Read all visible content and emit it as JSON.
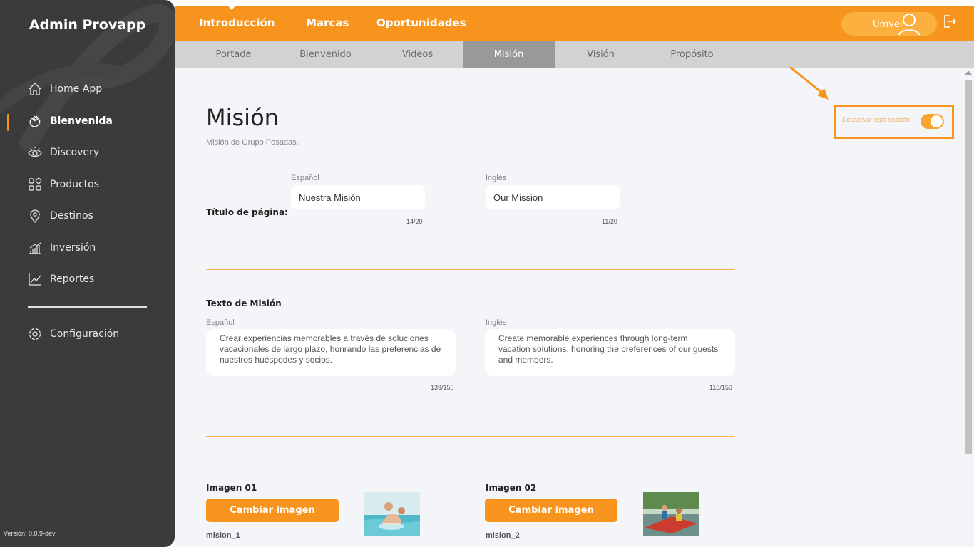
{
  "app": {
    "title": "Admin Provapp",
    "version": "Versión: 0.0.9-dev"
  },
  "sidebar": {
    "items": [
      {
        "label": "Home App",
        "icon": "home-icon"
      },
      {
        "label": "Bienvenida",
        "icon": "wave-hand-icon",
        "active": true
      },
      {
        "label": "Discovery",
        "icon": "eye-icon"
      },
      {
        "label": "Productos",
        "icon": "grid-icon"
      },
      {
        "label": "Destinos",
        "icon": "location-pin-icon"
      },
      {
        "label": "Inversión",
        "icon": "bar-chart-icon"
      },
      {
        "label": "Reportes",
        "icon": "line-chart-icon"
      }
    ],
    "settings": {
      "label": "Configuración",
      "icon": "gear-icon"
    }
  },
  "topnav": {
    "tabs": [
      "Introducción",
      "Marcas",
      "Oportunidades"
    ],
    "user": "Umvel"
  },
  "subnav": {
    "tabs": [
      "Portada",
      "Bienvenido",
      "Videos",
      "Misión",
      "Visión",
      "Propósito"
    ],
    "active": "Misión"
  },
  "page": {
    "title": "Misión",
    "subtitle": "Misión de Grupo Posadas.",
    "toggle_label": "Desactivar esta sección",
    "toggle_on": true
  },
  "title_section": {
    "label": "Título de página:",
    "es": {
      "lang": "Español",
      "value": "Nuestra Misión",
      "count": "14/20"
    },
    "en": {
      "lang": "Inglés",
      "value": "Our Mission",
      "count": "11/20"
    }
  },
  "text_section": {
    "label": "Texto de Misión",
    "es": {
      "lang": "Español",
      "value": "Crear experiencias memorables a través de soluciones vacacionales de largo plazo, honrando las preferencias de nuestros huéspedes y socios.",
      "count": "139/150"
    },
    "en": {
      "lang": "Inglés",
      "value": "Create memorable experiences through long-term vacation solutions, honoring the preferences of our guests and members.",
      "count": "118/150"
    }
  },
  "images": [
    {
      "label": "Imagen 01",
      "button": "Cambiar imagen",
      "filename": "mision_1"
    },
    {
      "label": "Imagen 02",
      "button": "Cambiar imagen",
      "filename": "mision_2"
    }
  ],
  "colors": {
    "accent": "#f7941d",
    "sidebar": "#3b3b3b",
    "background": "#f4f5f9"
  }
}
